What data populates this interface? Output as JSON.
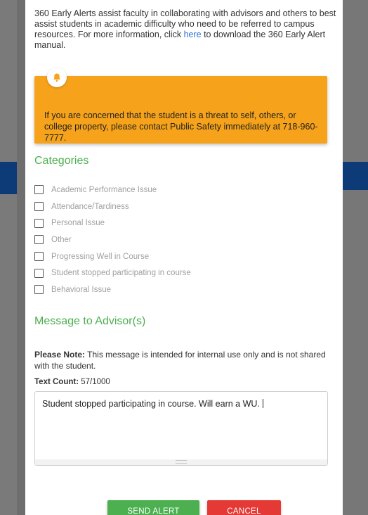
{
  "intro": {
    "text_before_link": "360 Early Alerts assist faculty in collaborating with advisors and others to best assist students in academic difficulty who need to be referred to campus resources. For more information, click ",
    "link": "here",
    "text_after_link": " to download the 360 Early Alert manual."
  },
  "warning": {
    "icon": "bell-icon",
    "text": "If you are concerned that the student is a threat to self, others, or college property, please contact Public Safety immediately at 718-960-7777.",
    "color": "#f6a21a"
  },
  "categories": {
    "heading": "Categories",
    "items": [
      {
        "label": "Academic Performance Issue",
        "checked": false
      },
      {
        "label": "Attendance/Tardiness",
        "checked": false
      },
      {
        "label": "Personal Issue",
        "checked": false
      },
      {
        "label": "Other",
        "checked": false
      },
      {
        "label": "Progressing Well in Course",
        "checked": false
      },
      {
        "label": "Student stopped participating in course",
        "checked": false
      },
      {
        "label": "Behavioral Issue",
        "checked": false
      }
    ]
  },
  "message": {
    "heading": "Message to Advisor(s)",
    "note_label": "Please Note:",
    "note_text": " This message is intended for internal use only and is not shared with the student.",
    "count_label": "Text Count:",
    "count_value": " 57/1000",
    "textarea_value": "Student stopped participating in course. Will earn a WU."
  },
  "buttons": {
    "send": "Send Alert",
    "cancel": "Cancel"
  },
  "colors": {
    "heading_green": "#4caf50",
    "send_green": "#4caf50",
    "cancel_red": "#e53935",
    "link_blue": "#2a6fd6"
  }
}
